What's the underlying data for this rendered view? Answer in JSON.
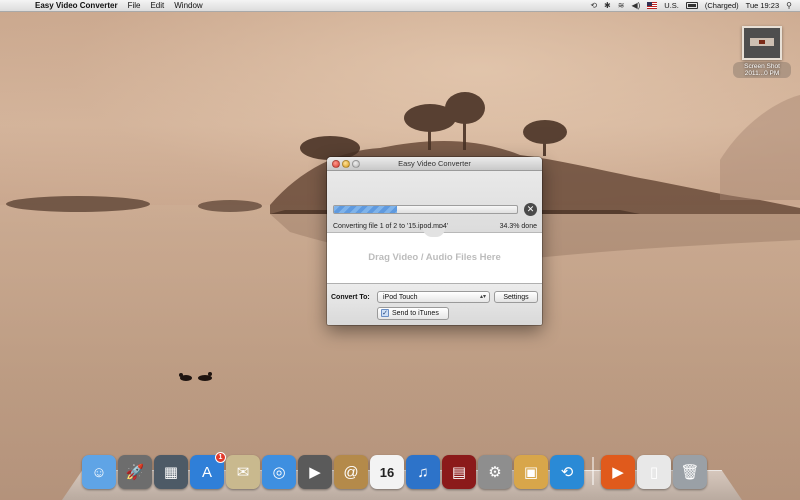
{
  "menubar": {
    "app_name": "Easy Video Converter",
    "menus": [
      "File",
      "Edit",
      "Window"
    ],
    "input_source": "U.S.",
    "battery_status": "(Charged)",
    "clock": "Tue 19:23"
  },
  "desktop": {
    "file_label": "Screen Shot 2011...0 PM"
  },
  "window": {
    "title": "Easy Video Converter",
    "progress": {
      "status_text": "Converting file 1 of 2 to '15.ipod.mp4'",
      "percent_text": "34.3% done",
      "fraction": 0.343
    },
    "drop_zone_text": "Drag Video / Audio Files Here",
    "convert_to_label": "Convert To:",
    "format_selected": "iPod Touch",
    "settings_label": "Settings",
    "send_to_itunes_label": "Send to iTunes",
    "send_to_itunes_checked": true
  },
  "dock": {
    "items": [
      {
        "name": "finder-icon",
        "color": "#5fa4e6"
      },
      {
        "name": "launchpad-icon",
        "color": "#6d6d6d"
      },
      {
        "name": "mission-control-icon",
        "color": "#4d5a66"
      },
      {
        "name": "app-store-icon",
        "color": "#2f7fd8",
        "badge": "1"
      },
      {
        "name": "mail-stamp-icon",
        "color": "#c9b98e"
      },
      {
        "name": "safari-icon",
        "color": "#3e8fe0"
      },
      {
        "name": "facetime-icon",
        "color": "#5a5a5a"
      },
      {
        "name": "address-book-icon",
        "color": "#b48a4a"
      },
      {
        "name": "ical-icon",
        "color": "#f3f3f3",
        "text": "16"
      },
      {
        "name": "itunes-icon",
        "color": "#2d73c9"
      },
      {
        "name": "photo-booth-icon",
        "color": "#8b1a1a"
      },
      {
        "name": "system-preferences-icon",
        "color": "#8e8e8e"
      },
      {
        "name": "iphoto-icon",
        "color": "#d8a64a"
      },
      {
        "name": "time-machine-icon",
        "color": "#2a8ad6"
      },
      {
        "name": "easy-video-converter-icon",
        "color": "#e05a1c"
      },
      {
        "name": "preview-document-icon",
        "color": "#e8e8e8"
      },
      {
        "name": "trash-icon",
        "color": "#9aa0a6"
      }
    ]
  }
}
